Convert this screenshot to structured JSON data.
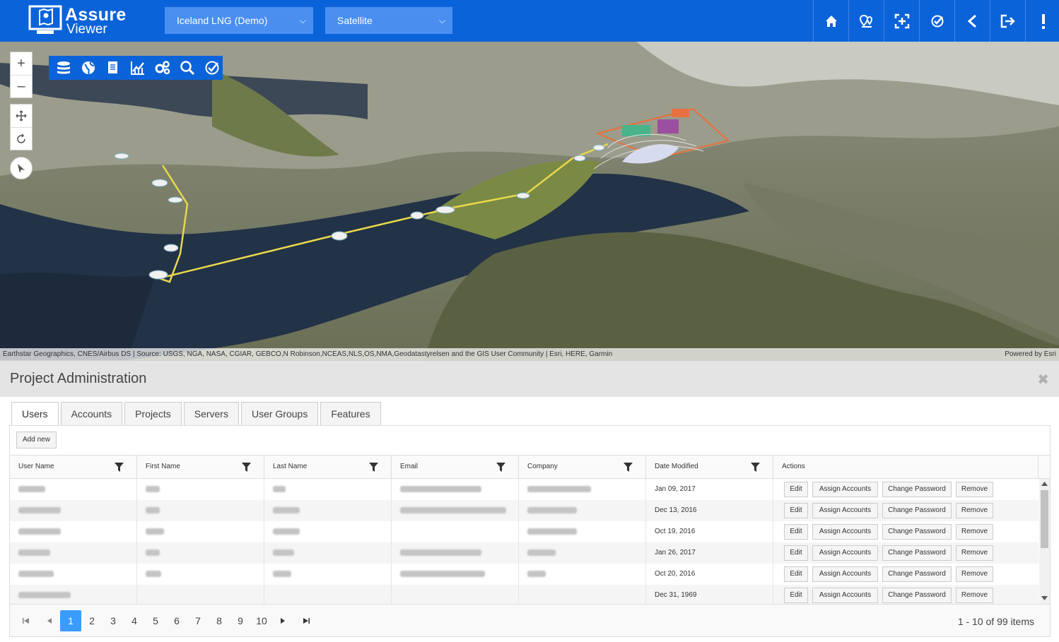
{
  "app": {
    "logo_line1": "Assure",
    "logo_line2": "Viewer"
  },
  "header": {
    "project_select": "Iceland LNG (Demo)",
    "basemap_select": "Satellite",
    "buttons": [
      "home-icon",
      "pins-icon",
      "zoom-extent-icon",
      "check-location-icon",
      "back-icon",
      "logout-icon",
      "alert-icon"
    ]
  },
  "map": {
    "zoom_in": "+",
    "zoom_out": "–",
    "attribution": "Earthstar Geographics, CNES/Airbus DS | Source: USGS, NGA, NASA, CGIAR, GEBCO,N Robinson,NCEAS,NLS,OS,NMA,Geodatastyrelsen and the GIS User Community | Esri, HERE, Garmin",
    "powered_by": "Powered by Esri",
    "tools": [
      "layers-icon",
      "globe-icon",
      "documents-icon",
      "chart-icon",
      "settings-icon",
      "search-icon",
      "check-icon"
    ]
  },
  "admin": {
    "title": "Project Administration",
    "tabs": [
      "Users",
      "Accounts",
      "Projects",
      "Servers",
      "User Groups",
      "Features"
    ],
    "add_new": "Add new",
    "columns": [
      "User Name",
      "First Name",
      "Last Name",
      "Email",
      "Company",
      "Date Modified",
      "Actions"
    ],
    "rows": [
      {
        "date": "Jan 09, 2017"
      },
      {
        "date": "Dec 13, 2016"
      },
      {
        "date": "Oct 19, 2016"
      },
      {
        "date": "Jan 26, 2017"
      },
      {
        "date": "Oct 20, 2016"
      },
      {
        "date": "Dec 31, 1969"
      }
    ],
    "actions": {
      "edit": "Edit",
      "assign": "Assign Accounts",
      "change_password": "Change Password",
      "remove": "Remove"
    },
    "pages": [
      "1",
      "2",
      "3",
      "4",
      "5",
      "6",
      "7",
      "8",
      "9",
      "10"
    ],
    "current_page": "1",
    "page_info": "1 - 10 of 99 items"
  },
  "colors": {
    "brand_blue": "#0b63d9",
    "dropdown_blue": "#4a8ff0",
    "pager_active": "#3b9cff"
  }
}
